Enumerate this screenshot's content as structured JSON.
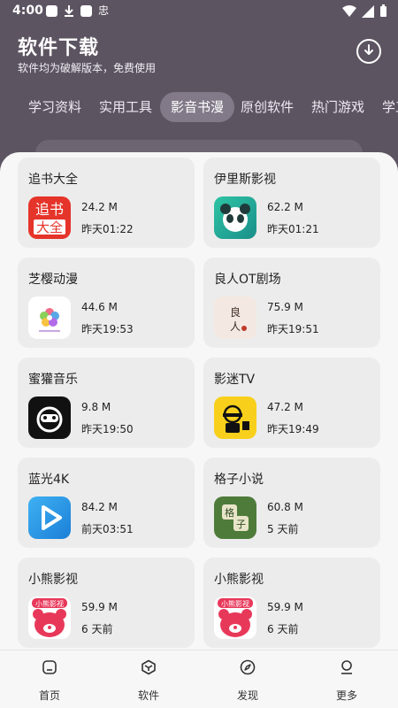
{
  "status_bar": {
    "time": "4:00",
    "misc_glyph": "忠"
  },
  "header": {
    "title": "软件下载",
    "subtitle": "软件均为破解版本，免费使用",
    "download_icon": "download-icon"
  },
  "tabs": [
    {
      "label": "学习资料"
    },
    {
      "label": "实用工具"
    },
    {
      "label": "影音书漫",
      "active": true
    },
    {
      "label": "原创软件"
    },
    {
      "label": "热门游戏"
    },
    {
      "label": "学工"
    }
  ],
  "apps": [
    {
      "name": "追书大全",
      "size": "24.2 M",
      "time": "昨天01:22",
      "icon_text_1": "追书",
      "icon_text_2": "大全"
    },
    {
      "name": "伊里斯影视",
      "size": "62.2 M",
      "time": "昨天01:21"
    },
    {
      "name": "芝樱动漫",
      "size": "44.6 M",
      "time": "昨天19:53"
    },
    {
      "name": "良人OT剧场",
      "size": "75.9 M",
      "time": "昨天19:51",
      "icon_text_1": "良",
      "icon_text_2": "人"
    },
    {
      "name": "蜜獾音乐",
      "size": "9.8 M",
      "time": "昨天19:50"
    },
    {
      "name": "影迷TV",
      "size": "47.2 M",
      "time": "昨天19:49"
    },
    {
      "name": "蓝光4K",
      "size": "84.2 M",
      "time": "前天03:51"
    },
    {
      "name": "格子小说",
      "size": "60.8 M",
      "time": "5 天前",
      "icon_text_1": "格",
      "icon_text_2": "子"
    },
    {
      "name": "小熊影视",
      "size": "59.9 M",
      "time": "6 天前",
      "icon_text_1": "小熊影视"
    },
    {
      "name": "小熊影视",
      "size": "59.9 M",
      "time": "6 天前",
      "icon_text_1": "小熊影视"
    }
  ],
  "nav": [
    {
      "label": "首页",
      "icon": "home-icon"
    },
    {
      "label": "软件",
      "icon": "cube-icon"
    },
    {
      "label": "发现",
      "icon": "compass-icon"
    },
    {
      "label": "更多",
      "icon": "person-icon"
    }
  ]
}
